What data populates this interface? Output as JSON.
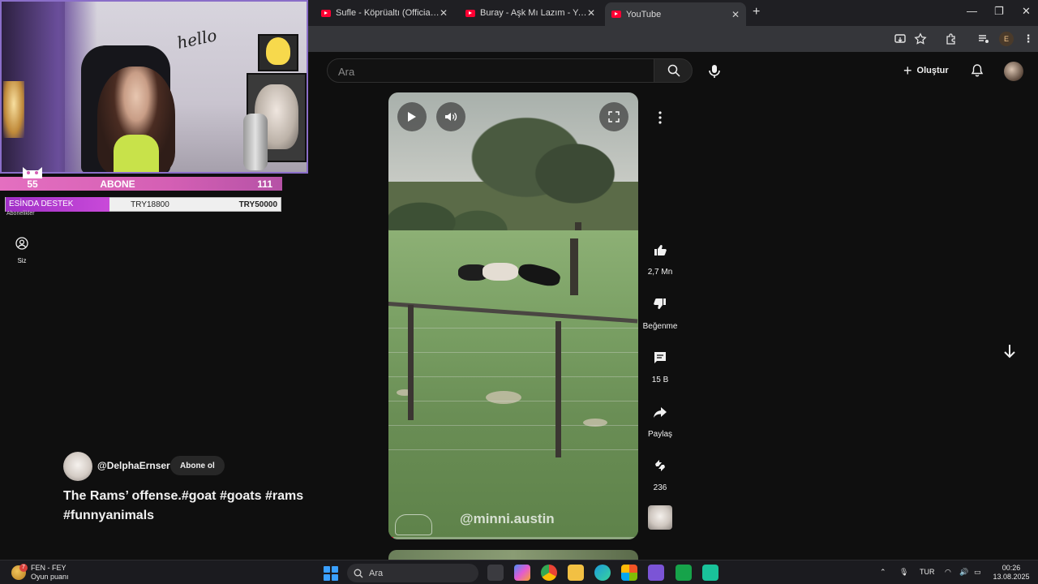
{
  "browser": {
    "tabs": [
      {
        "label": "Sufle - Köprüaltı (Official Video)",
        "active": false
      },
      {
        "label": "Buray - Aşk Mı Lazım - YouTube",
        "active": false
      },
      {
        "label": "YouTube",
        "active": true
      }
    ],
    "profile_initial": "E"
  },
  "youtube": {
    "search": {
      "placeholder": "Ara"
    },
    "create_label": "Oluştur",
    "sidebar": {
      "you_label": "Siz"
    },
    "short": {
      "watermark": "@minni.austin",
      "progress": 0.02,
      "actions": {
        "likes": "2,7 Mn",
        "dislike_label": "Beğenme",
        "comments": "15 B",
        "share_label": "Paylaş",
        "remix": "236"
      },
      "channel": "@DelphaErnser",
      "subscribe_label": "Abone ol",
      "title": "The Rams’ offense.#goat #goats #rams #funnyanimals"
    }
  },
  "stream_overlay": {
    "left_count": "55",
    "center_label": "ABONE",
    "right_count": "111",
    "donation": {
      "label": "ESİNDA DESTEK",
      "current": "TRY18800",
      "goal": "TRY50000"
    },
    "subtext": "Abonelikler",
    "webcam_sign": "hello"
  },
  "taskbar": {
    "weather": {
      "badge": "7",
      "line1": "FEN - FEY",
      "line2": "Oyun puanı"
    },
    "search_placeholder": "Ara",
    "lang": "TUR",
    "time": "00:26",
    "date": "13.08.2025"
  },
  "colors": {
    "accent_red": "#ff0033",
    "overlay_pink": "#e46fc0",
    "overlay_purple": "#a02fc7"
  }
}
